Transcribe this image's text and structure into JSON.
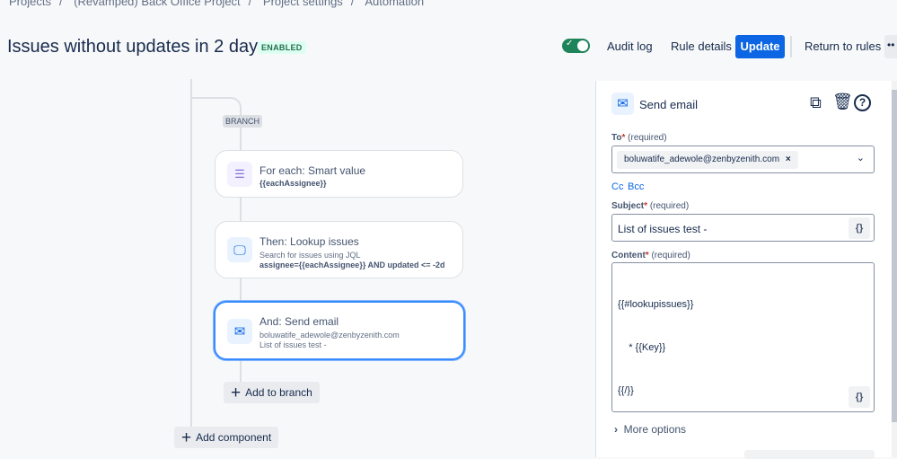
{
  "breadcrumb": [
    "Projects",
    "(Revamped) Back Office Project",
    "Project settings",
    "Automation"
  ],
  "header": {
    "title": "Issues without updates in 2 days",
    "status": "ENABLED",
    "toggle_on": true,
    "audit_log": "Audit log",
    "rule_details": "Rule details",
    "update": "Update",
    "return": "Return to rules",
    "more": "••"
  },
  "canvas": {
    "branch_label": "BRANCH",
    "cards": [
      {
        "title": "For each: Smart value",
        "bold": "{{eachAssignee}}"
      },
      {
        "title": "Then: Lookup issues",
        "sub": "Search for issues using JQL",
        "bold": "assignee={{eachAssignee}} AND updated <= -2d"
      },
      {
        "title": "And: Send email",
        "sub": "boluwatife_adewole@zenbyzenith.com",
        "sub2": "List of issues test -"
      }
    ],
    "add_to_branch": "Add to branch",
    "add_component": "Add component"
  },
  "panel": {
    "title": "Send email",
    "to_label": "To",
    "required": "(required)",
    "to_value": "boluwatife_adewole@zenbyzenith.com",
    "cc": "Cc",
    "bcc": "Bcc",
    "subject_label": "Subject",
    "subject_value": "List of issues test -",
    "content_label": "Content",
    "content_lines": [
      "{{#lookupissues}}",
      "    * {{Key}}",
      "{{/}}"
    ],
    "curly": "{}",
    "more_options": "More options"
  },
  "colors": {
    "primary": "#0c66e4",
    "success": "#1f845a"
  }
}
